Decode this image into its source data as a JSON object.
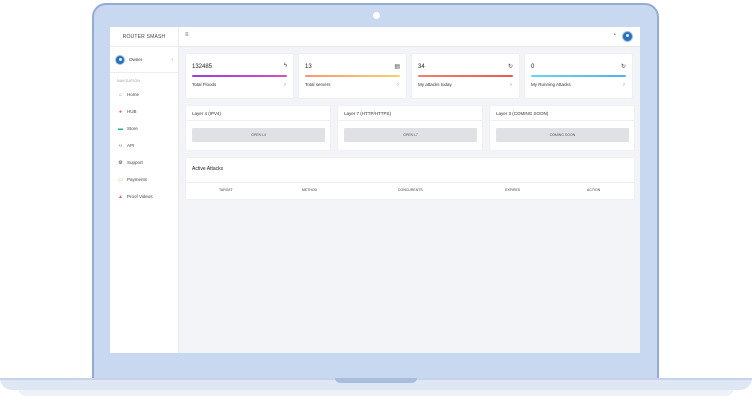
{
  "brand": "ROUTER SMASH",
  "user": {
    "name": "Owner",
    "caret": "‹"
  },
  "nav": {
    "title": "NAVIGATION",
    "items": [
      {
        "label": "Home",
        "icon": "⌂",
        "icon_color": "#3f8fe0"
      },
      {
        "label": "HUB",
        "icon": "●",
        "icon_color": "#e05a5a"
      },
      {
        "label": "Store",
        "icon": "▬",
        "icon_color": "#21b5a0"
      },
      {
        "label": "API",
        "icon": "‹›",
        "icon_color": "#555555"
      },
      {
        "label": "Support",
        "icon": "⚙",
        "icon_color": "#333333"
      },
      {
        "label": "Payments",
        "icon": "▭",
        "icon_color": "#e0a23a"
      },
      {
        "label": "Proof Videos",
        "icon": "▲",
        "icon_color": "#e05a7a"
      }
    ]
  },
  "topbar": {
    "menu_icon": "≡",
    "dot": "•"
  },
  "stats": [
    {
      "value": "132485",
      "label": "Total Floods",
      "icon": "ϟ",
      "q": "?",
      "bar": "linear-gradient(90deg,#9c3fd4,#d64fc9)"
    },
    {
      "value": "13",
      "label": "Total servers",
      "icon": "▤",
      "q": "?",
      "bar": "linear-gradient(90deg,#f49a7a,#f4d36a)"
    },
    {
      "value": "34",
      "label": "My attacks today",
      "icon": "↻",
      "q": "?",
      "bar": "linear-gradient(90deg,#f47d6a,#e85d4a)"
    },
    {
      "value": "0",
      "label": "My Running Attacks",
      "icon": "↻",
      "q": "?",
      "bar": "linear-gradient(90deg,#6ad4f4,#4ab8e8)"
    }
  ],
  "layers": [
    {
      "title": "Layer 4 (IPV4)",
      "button": "OPEN L4"
    },
    {
      "title": "Layer 7 (HTTP/HTTPS)",
      "button": "OPEN L7"
    },
    {
      "title": "Layer 3 (COMING SOON)",
      "button": "COMING SOON"
    }
  ],
  "active_attacks": {
    "title": "Active Attacks",
    "columns": [
      "TARGET",
      "METHOD",
      "CONCURENTS",
      "EXPIRES",
      "ACTION"
    ]
  }
}
